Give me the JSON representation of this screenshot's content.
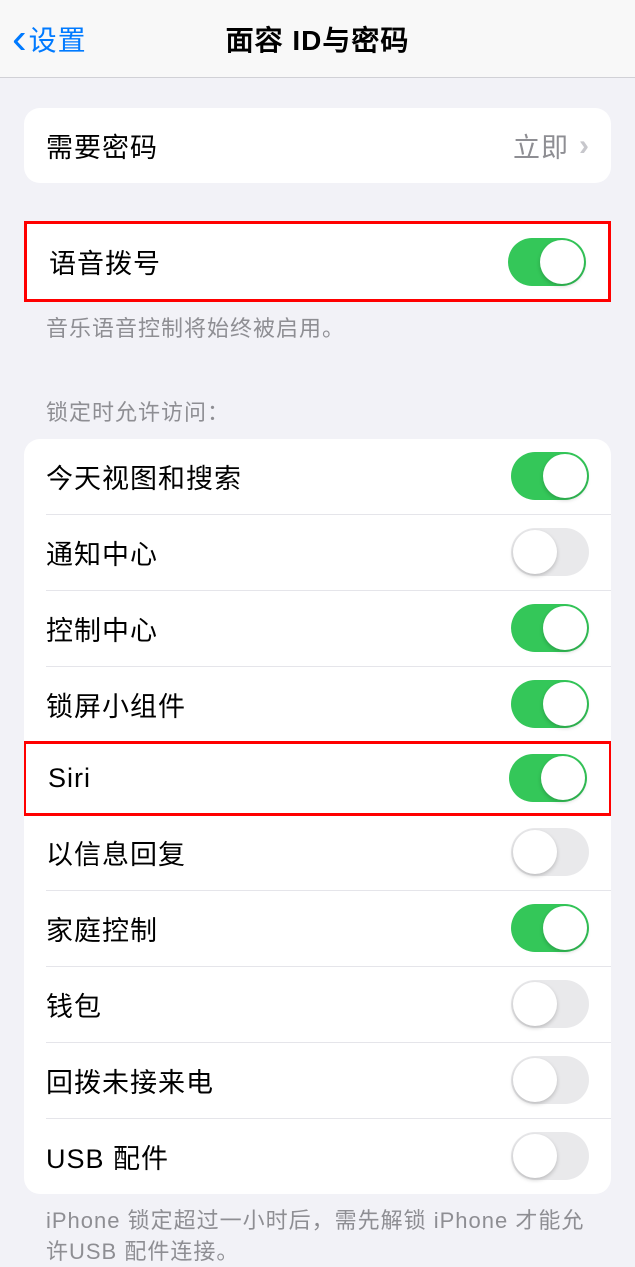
{
  "nav": {
    "back_label": "设置",
    "title": "面容 ID与密码"
  },
  "passcode": {
    "label": "需要密码",
    "value": "立即"
  },
  "voice_dial": {
    "label": "语音拨号",
    "enabled": true,
    "footer": "音乐语音控制将始终被启用。"
  },
  "lock_header": "锁定时允许访问：",
  "lock_items": [
    {
      "label": "今天视图和搜索",
      "enabled": true,
      "highlighted": false
    },
    {
      "label": "通知中心",
      "enabled": false,
      "highlighted": false
    },
    {
      "label": "控制中心",
      "enabled": true,
      "highlighted": false
    },
    {
      "label": "锁屏小组件",
      "enabled": true,
      "highlighted": false
    },
    {
      "label": "Siri",
      "enabled": true,
      "highlighted": true
    },
    {
      "label": "以信息回复",
      "enabled": false,
      "highlighted": false
    },
    {
      "label": "家庭控制",
      "enabled": true,
      "highlighted": false
    },
    {
      "label": "钱包",
      "enabled": false,
      "highlighted": false
    },
    {
      "label": "回拨未接来电",
      "enabled": false,
      "highlighted": false
    },
    {
      "label": "USB 配件",
      "enabled": false,
      "highlighted": false
    }
  ],
  "lock_footer": "iPhone 锁定超过一小时后，需先解锁 iPhone 才能允许USB 配件连接。"
}
